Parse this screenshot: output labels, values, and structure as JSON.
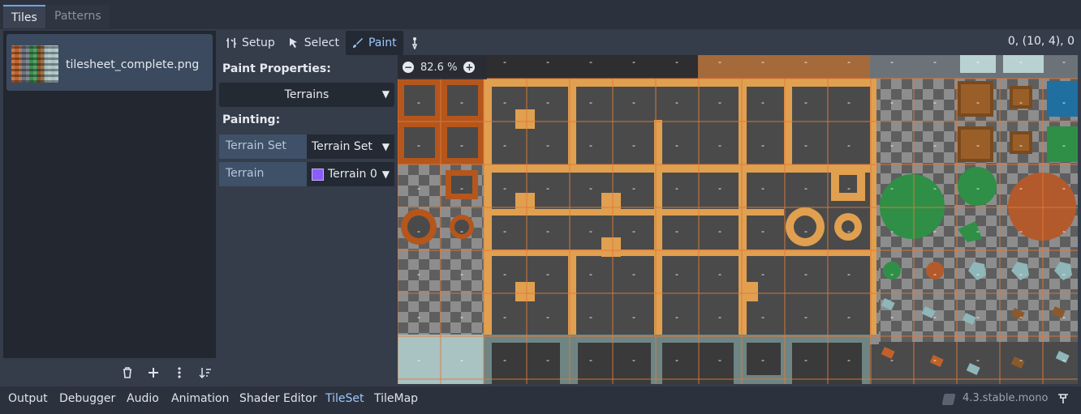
{
  "tabs": {
    "tiles": "Tiles",
    "patterns": "Patterns"
  },
  "source_list": {
    "items": [
      {
        "name": "tilesheet_complete.png"
      }
    ]
  },
  "toolbar": {
    "setup": "Setup",
    "select": "Select",
    "paint": "Paint",
    "active": "Paint"
  },
  "coords_readout": "0, (10, 4), 0",
  "properties": {
    "paint_properties_label": "Paint Properties:",
    "paint_mode": "Terrains",
    "painting_label": "Painting:",
    "terrain_set_label": "Terrain Set",
    "terrain_set_value": "Terrain Set",
    "terrain_label": "Terrain",
    "terrain_value": "Terrain 0",
    "terrain_color": "#8b5cff"
  },
  "zoom": {
    "level": "82.6 %"
  },
  "tile_marker": "-",
  "bottom_panel": {
    "tabs": [
      "Output",
      "Debugger",
      "Audio",
      "Animation",
      "Shader Editor",
      "TileSet",
      "TileMap"
    ],
    "active": "TileSet",
    "version": "4.3.stable.mono"
  },
  "colors": {
    "accent": "#9cc6ff",
    "grid": "#e07a3a",
    "wood": "#e0a050",
    "dark_tile": "#4a4a4a"
  }
}
